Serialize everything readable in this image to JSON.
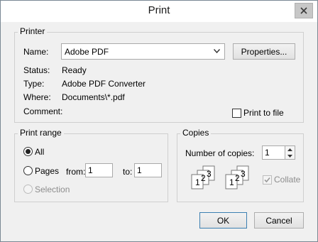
{
  "window": {
    "title": "Print"
  },
  "printer": {
    "group_label": "Printer",
    "name_label": "Name:",
    "name_value": "Adobe PDF",
    "properties_label": "Properties...",
    "status_label": "Status:",
    "status_value": "Ready",
    "type_label": "Type:",
    "type_value": "Adobe PDF Converter",
    "where_label": "Where:",
    "where_value": "Documents\\*.pdf",
    "comment_label": "Comment:",
    "print_to_file_label": "Print to file",
    "print_to_file_checked": false
  },
  "print_range": {
    "group_label": "Print range",
    "all_label": "All",
    "pages_label": "Pages",
    "from_label": "from:",
    "from_value": "1",
    "to_label": "to:",
    "to_value": "1",
    "selection_label": "Selection",
    "selected": "All"
  },
  "copies": {
    "group_label": "Copies",
    "number_label": "Number of copies:",
    "number_value": "1",
    "collate_label": "Collate",
    "collate_checked": true,
    "collate_disabled": true,
    "page_numbers": [
      "1",
      "2",
      "3"
    ]
  },
  "buttons": {
    "ok_label": "OK",
    "cancel_label": "Cancel"
  }
}
